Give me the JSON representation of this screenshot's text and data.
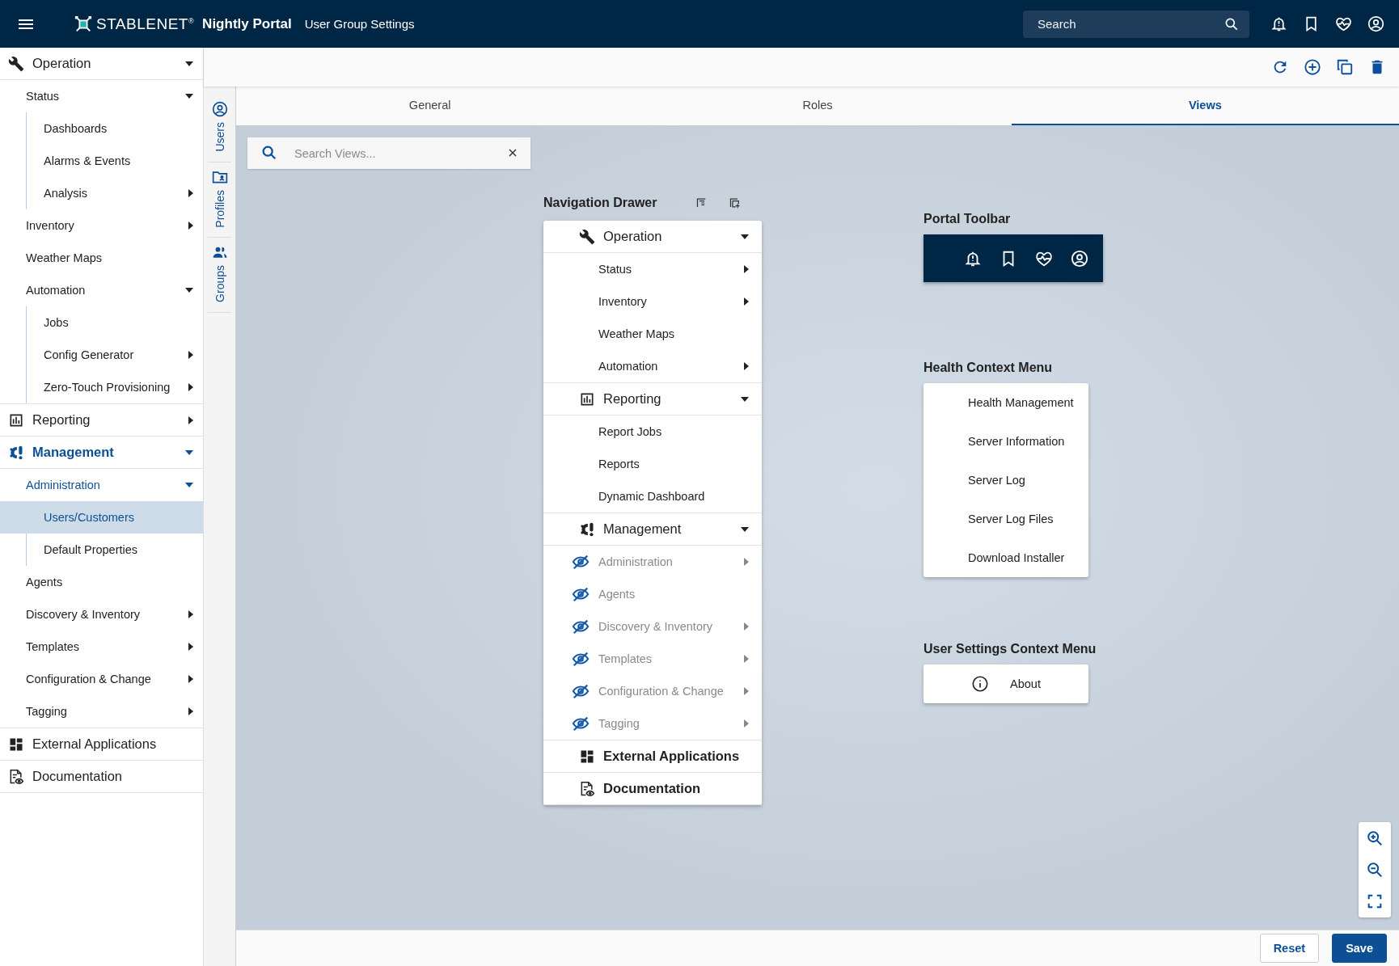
{
  "header": {
    "brand": "STABLENET$^{®}$",
    "product": "Nightly Portal",
    "page_title": "User Group Settings",
    "search": {
      "placeholder": "Search"
    }
  },
  "sidebar": {
    "sections": [
      {
        "label": "Operation",
        "kind": "group",
        "expanded": true,
        "selected": false,
        "children": [
          {
            "label": "Status",
            "kind": "group",
            "expanded": true,
            "selected": false,
            "children": [
              {
                "label": "Dashboards",
                "kind": "link",
                "selected": false
              },
              {
                "label": "Alarms & Events",
                "kind": "link",
                "selected": false
              },
              {
                "label": "Analysis",
                "kind": "group",
                "expanded": false,
                "selected": false
              }
            ]
          },
          {
            "label": "Inventory",
            "kind": "group",
            "expanded": false,
            "selected": false
          },
          {
            "label": "Weather Maps",
            "kind": "link",
            "selected": false
          },
          {
            "label": "Automation",
            "kind": "group",
            "expanded": true,
            "selected": false,
            "children": [
              {
                "label": "Jobs",
                "kind": "link",
                "selected": false
              },
              {
                "label": "Config Generator",
                "kind": "group",
                "expanded": false,
                "selected": false
              },
              {
                "label": "Zero-Touch Provisioning",
                "kind": "group",
                "expanded": false,
                "selected": false
              }
            ]
          }
        ]
      },
      {
        "label": "Reporting",
        "kind": "group",
        "expanded": false,
        "selected": false
      },
      {
        "label": "Management",
        "kind": "group",
        "expanded": true,
        "selected": false,
        "children": [
          {
            "label": "Administration",
            "kind": "group",
            "expanded": true,
            "selected": false,
            "children": [
              {
                "label": "Users/Customers",
                "kind": "link",
                "selected": true
              },
              {
                "label": "Default Properties",
                "kind": "link",
                "selected": false
              }
            ]
          },
          {
            "label": "Agents",
            "kind": "link",
            "selected": false
          },
          {
            "label": "Discovery & Inventory",
            "kind": "group",
            "expanded": false,
            "selected": false
          },
          {
            "label": "Templates",
            "kind": "group",
            "expanded": false,
            "selected": false
          },
          {
            "label": "Configuration & Change",
            "kind": "group",
            "expanded": false,
            "selected": false
          },
          {
            "label": "Tagging",
            "kind": "group",
            "expanded": false,
            "selected": false
          }
        ]
      },
      {
        "label": "External Applications",
        "kind": "link",
        "selected": false
      },
      {
        "label": "Documentation",
        "kind": "link",
        "selected": false
      }
    ]
  },
  "side_tabs": [
    {
      "label": "Users"
    },
    {
      "label": "Profiles"
    },
    {
      "label": "Groups"
    }
  ],
  "tabs": [
    {
      "label": "General",
      "selected": false
    },
    {
      "label": "Roles",
      "selected": false
    },
    {
      "label": "Views",
      "selected": true
    }
  ],
  "view_search": {
    "placeholder": "Search Views..."
  },
  "navigation_drawer": {
    "title": "Navigation Drawer",
    "sections": [
      {
        "label": "Operation",
        "kind": "group",
        "expanded": true,
        "items": [
          {
            "label": "Status",
            "kind": "group",
            "hidden": false
          },
          {
            "label": "Inventory",
            "kind": "group",
            "hidden": false
          },
          {
            "label": "Weather Maps",
            "kind": "link",
            "hidden": false
          },
          {
            "label": "Automation",
            "kind": "group",
            "hidden": false
          }
        ]
      },
      {
        "label": "Reporting",
        "kind": "group",
        "expanded": true,
        "items": [
          {
            "label": "Report Jobs",
            "kind": "link",
            "hidden": false
          },
          {
            "label": "Reports",
            "kind": "link",
            "hidden": false
          },
          {
            "label": "Dynamic Dashboard",
            "kind": "link",
            "hidden": false
          }
        ]
      },
      {
        "label": "Management",
        "kind": "group",
        "expanded": true,
        "items": [
          {
            "label": "Administration",
            "kind": "group",
            "hidden": true
          },
          {
            "label": "Agents",
            "kind": "link",
            "hidden": true
          },
          {
            "label": "Discovery & Inventory",
            "kind": "group",
            "hidden": true
          },
          {
            "label": "Templates",
            "kind": "group",
            "hidden": true
          },
          {
            "label": "Configuration & Change",
            "kind": "group",
            "hidden": true
          },
          {
            "label": "Tagging",
            "kind": "group",
            "hidden": true
          }
        ]
      },
      {
        "label": "External Applications",
        "kind": "link"
      },
      {
        "label": "Documentation",
        "kind": "link"
      }
    ]
  },
  "portal_toolbar": {
    "title": "Portal Toolbar"
  },
  "health_menu": {
    "title": "Health Context Menu",
    "items": [
      "Health Management",
      "Server Information",
      "Server Log",
      "Server Log Files",
      "Download Installer"
    ]
  },
  "user_settings_menu": {
    "title": "User Settings Context Menu",
    "items": [
      "About"
    ]
  },
  "footer": {
    "buttons": [
      {
        "label": "Reset",
        "kind": "secondary"
      },
      {
        "label": "Save",
        "kind": "primary"
      }
    ]
  }
}
